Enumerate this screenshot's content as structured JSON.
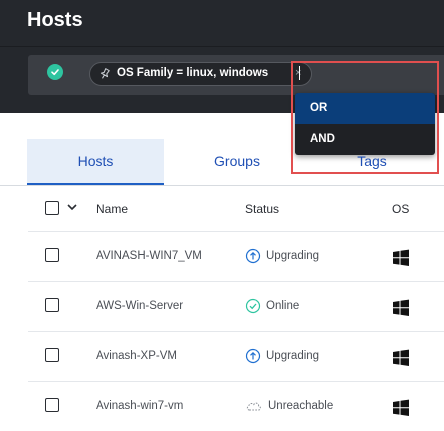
{
  "header": {
    "title": "Hosts"
  },
  "filter": {
    "chip_text": "OS Family =  linux, windows",
    "chip_close": "×",
    "input_value": ""
  },
  "dropdown": {
    "options": [
      "OR",
      "AND"
    ],
    "selected": "OR"
  },
  "tabs": [
    {
      "label": "Hosts",
      "active": true
    },
    {
      "label": "Groups",
      "active": false
    },
    {
      "label": "Tags",
      "active": false
    }
  ],
  "table": {
    "columns": [
      "Name",
      "Status",
      "OS"
    ],
    "rows": [
      {
        "name": "AVINASH-WIN7_VM",
        "status": "Upgrading",
        "status_icon": "upgrade-icon",
        "os": "windows-icon"
      },
      {
        "name": "AWS-Win-Server",
        "status": "Online",
        "status_icon": "online-check-icon",
        "os": "windows-icon"
      },
      {
        "name": "Avinash-XP-VM",
        "status": "Upgrading",
        "status_icon": "upgrade-icon",
        "os": "windows-icon"
      },
      {
        "name": "Avinash-win7-vm",
        "status": "Unreachable",
        "status_icon": "cloud-unreachable-icon",
        "os": "windows-icon"
      }
    ]
  },
  "colors": {
    "header_bg": "#25282d",
    "accent_blue": "#1f4fb4",
    "online_green": "#2ec4a0",
    "upgrade_blue": "#1f6fd0",
    "highlight_red": "#e14f4f"
  }
}
